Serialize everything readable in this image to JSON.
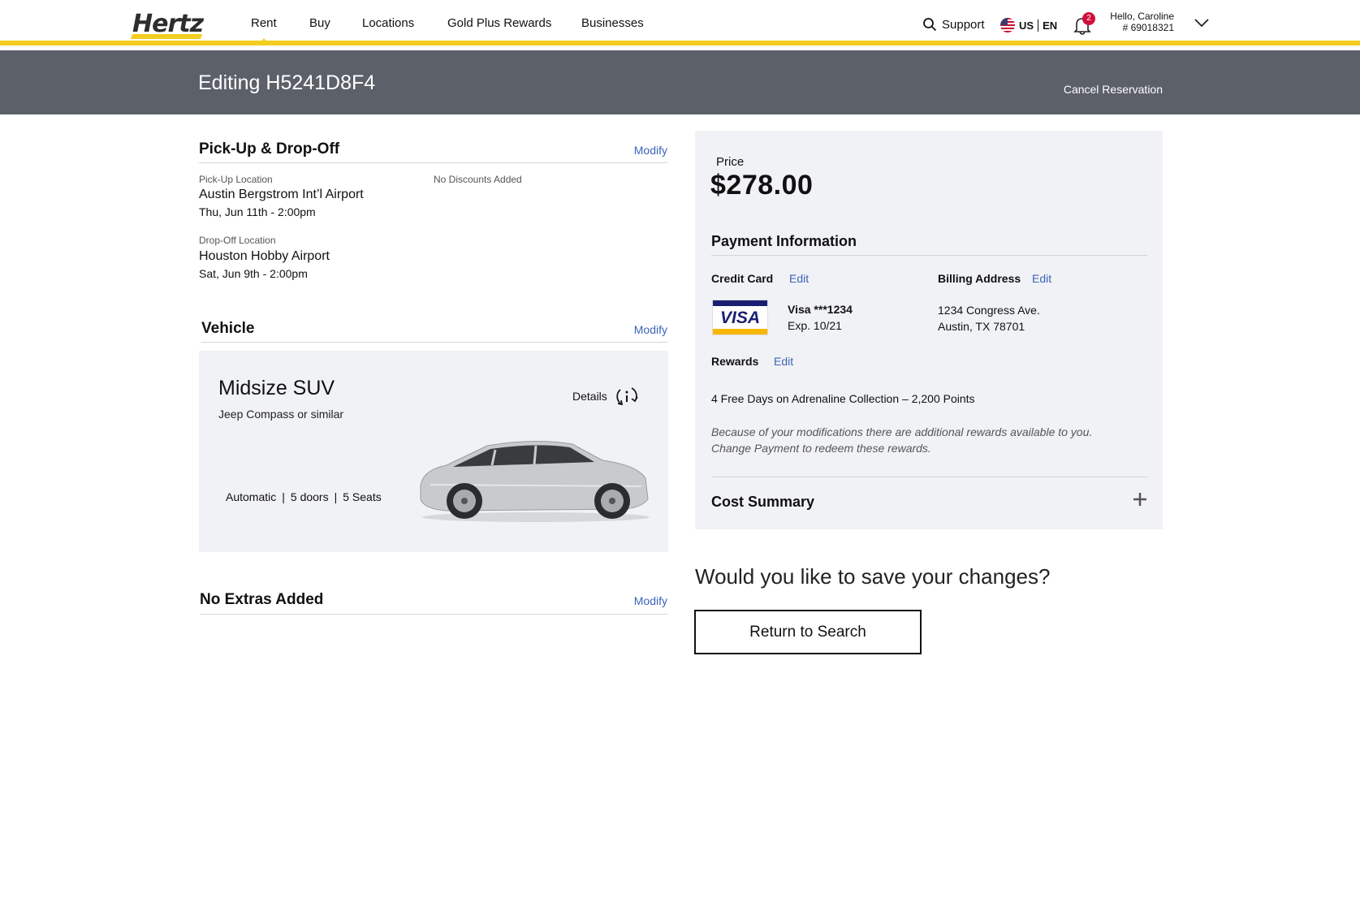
{
  "header": {
    "logo_text": "Hertz",
    "nav": [
      "Rent",
      "Buy",
      "Locations",
      "Gold Plus Rewards",
      "Businesses"
    ],
    "support_label": "Support",
    "country": "US",
    "language": "EN",
    "notification_count": "2",
    "greeting": "Hello, Caroline",
    "member_number": "# 69018321"
  },
  "banner": {
    "title": "Editing H5241D8F4",
    "cancel_label": "Cancel Reservation"
  },
  "pickup_dropoff": {
    "title": "Pick-Up & Drop-Off",
    "modify_label": "Modify",
    "pickup_label": "Pick-Up Location",
    "pickup_name": "Austin Bergstrom Int’l Airport",
    "pickup_date": "Thu, Jun 11th - 2:00pm",
    "dropoff_label": "Drop-Off Location",
    "dropoff_name": "Houston Hobby Airport",
    "dropoff_date": "Sat, Jun 9th - 2:00pm",
    "discounts": "No Discounts Added"
  },
  "vehicle": {
    "title": "Vehicle",
    "modify_label": "Modify",
    "class": "Midsize SUV",
    "model": "Jeep Compass or similar",
    "details_label": "Details",
    "specs": [
      "Automatic",
      "|",
      "5 doors",
      "|",
      "5 Seats"
    ]
  },
  "extras": {
    "title": "No Extras Added",
    "modify_label": "Modify"
  },
  "payment": {
    "price_label": "Price",
    "price_value": "$278.00",
    "title": "Payment Information",
    "credit_card_label": "Credit Card",
    "edit_label": "Edit",
    "card_brand_text": "VISA",
    "card_number": "Visa ***1234",
    "card_exp": "Exp. 10/21",
    "billing_label": "Billing Address",
    "billing_line1": "1234 Congress Ave.",
    "billing_line2": "Austin, TX 78701",
    "rewards_label": "Rewards",
    "rewards_value": "4 Free Days on Adrenaline Collection – 2,200 Points",
    "rewards_note": "Because of your modifications there are additional rewards available to you. Change Payment to redeem these rewards.",
    "cost_summary_label": "Cost Summary"
  },
  "save": {
    "question": "Would you like to save your changes?",
    "return_label": "Return to Search"
  },
  "colors": {
    "brand_yellow": "#f3cd1f",
    "banner_gray": "#5c6069",
    "link_blue": "#3b64b8",
    "panel_bg": "#f1f2f5",
    "badge_red": "#d0103a"
  }
}
